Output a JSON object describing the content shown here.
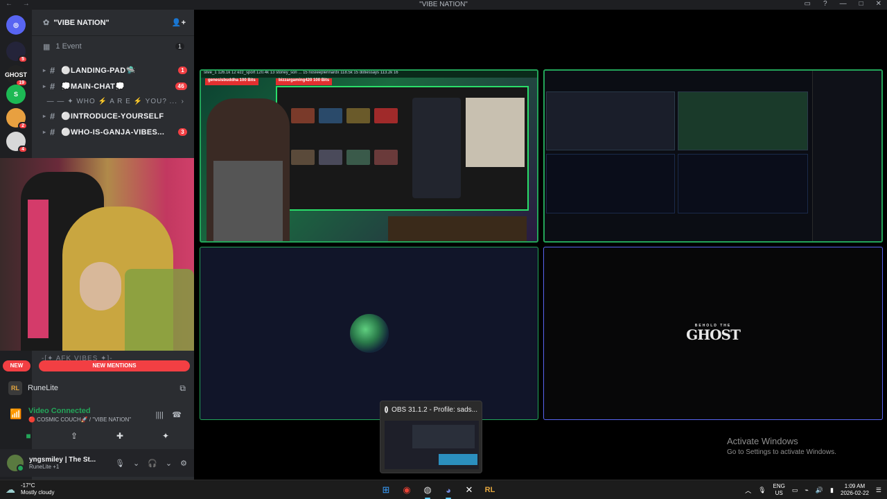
{
  "window": {
    "title": "\"VIBE NATION\""
  },
  "server": {
    "name": "\"VIBE NATION\"",
    "event_label": "1 Event",
    "event_count": "1"
  },
  "servers": [
    {
      "abbr": "",
      "color": "#24243a",
      "badge": "5"
    },
    {
      "abbr": "GHOST",
      "color": "#222222",
      "badge": "19"
    },
    {
      "abbr": "S",
      "color": "#1db954",
      "badge": ""
    },
    {
      "abbr": "",
      "color": "#e8a040",
      "badge": "2"
    },
    {
      "abbr": "",
      "color": "#d8d8d8",
      "badge": "4"
    }
  ],
  "channels": [
    {
      "label": "⚪LANDING-PAD🛸",
      "count": "1"
    },
    {
      "label": "💭MAIN-CHAT💭",
      "count": "46"
    },
    {
      "label": "⚪INTRODUCE-YOURSELF",
      "count": ""
    },
    {
      "label": "⚪WHO-IS-GANJA-VIBES...",
      "count": "3"
    }
  ],
  "category": {
    "label": "— — ✦ WHO ⚡ A R E ⚡ YOU? ..."
  },
  "mentions": {
    "new_label": "NEW",
    "mentions_label": "NEW MENTIONS",
    "afk_label": "-[✦ AFK VIBES ✦]-"
  },
  "activity": {
    "app_icon": "RL",
    "app": "RuneLite"
  },
  "voice": {
    "status": "Video Connected",
    "channel": "🔴 COSMIC COUCH🚀 / \"VIBE NATION\""
  },
  "user": {
    "name": "yngsmiley | The St...",
    "status": "RuneLite +1"
  },
  "stream_tile1": {
    "banner": "slive_1  126.1k  12   ezz_sport  120.4k  13   stoney_son  ...  15   nosleeplennardx  118.5k  15   dotiessays  113.2k  16",
    "bit1": "genesisbuddha  100 Bits",
    "bit2": "bizzargaming420  100 Bits"
  },
  "ghost_tile": {
    "small": "BEHOLD THE",
    "big": "GHOST"
  },
  "obs_preview": {
    "title": "OBS 31.1.2 - Profile: sads..."
  },
  "watermark": {
    "line1": "Activate Windows",
    "line2": "Go to Settings to activate Windows."
  },
  "taskbar": {
    "temp": "-17°C",
    "weather": "Mostly cloudy",
    "lang1": "ENG",
    "lang2": "US",
    "time": "1:09 AM",
    "date": "2026-02-22"
  }
}
